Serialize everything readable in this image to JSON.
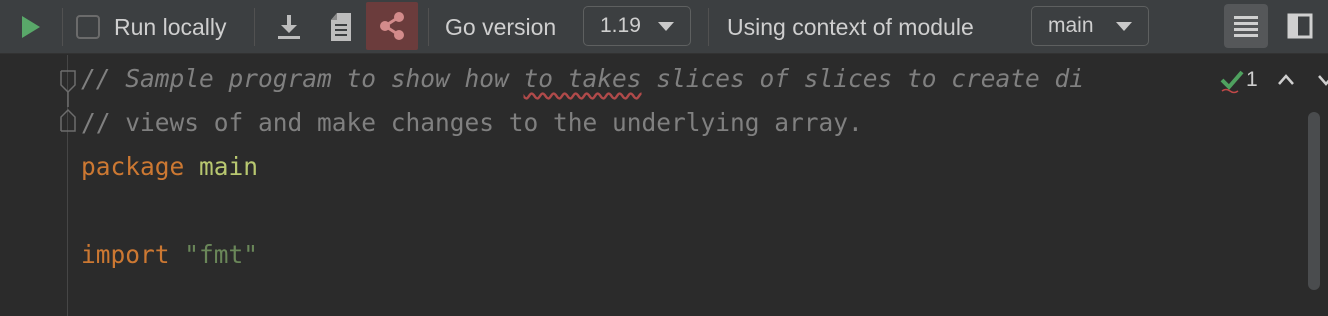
{
  "toolbar": {
    "run_locally_label": "Run locally",
    "go_version_label": "Go version",
    "go_version_value": "1.19",
    "context_label": "Using context of module",
    "module_value": "main",
    "colors": {
      "run": "#59a869",
      "share_active_bg": "#6b3c3c",
      "share_icon": "#d38b8b"
    }
  },
  "editor": {
    "lines": [
      {
        "parts": [
          "// Sample program to show how ",
          "to takes",
          " slices of slices to create di"
        ]
      },
      {
        "text": "// views of and make changes to the underlying array."
      },
      {
        "kw": "package",
        "name": "main"
      },
      {
        "kw": "import",
        "str": "\"fmt\""
      }
    ]
  },
  "inspections": {
    "count": "1"
  }
}
